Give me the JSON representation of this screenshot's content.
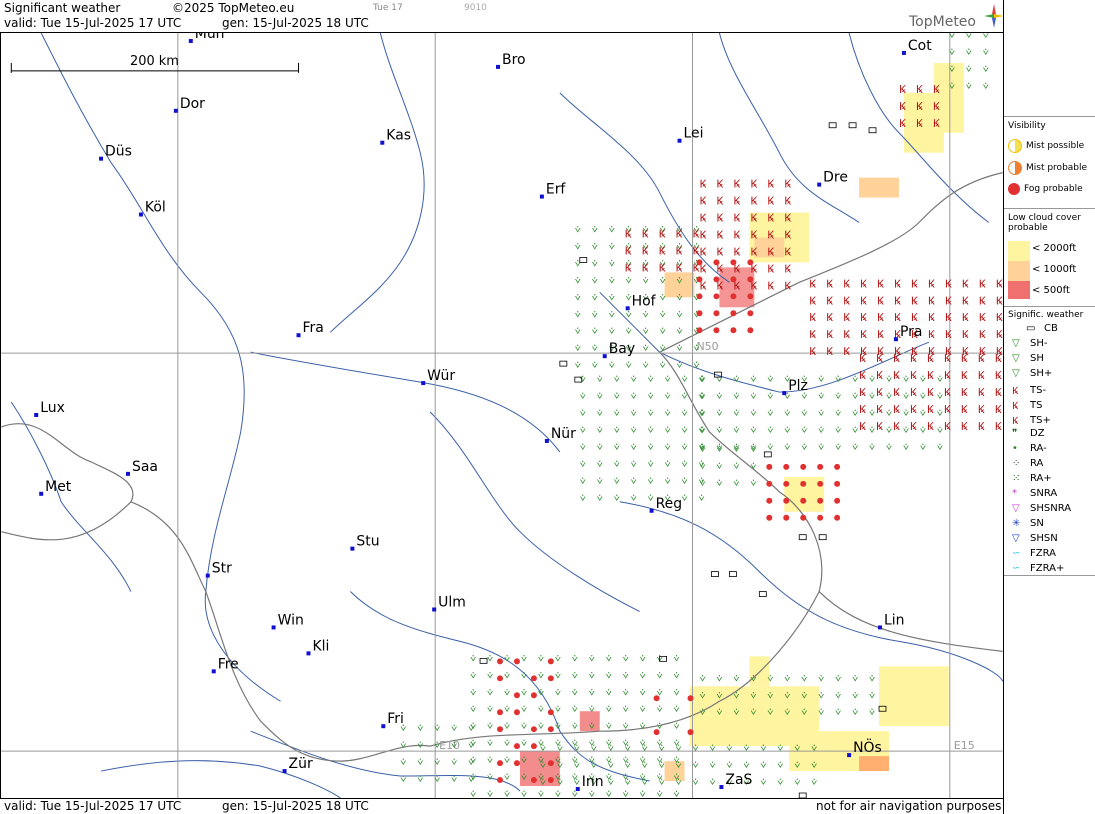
{
  "header": {
    "title": "Significant weather",
    "copyright": "©2025 TopMeteo.eu",
    "tab_day": "Tue 17",
    "code": "9010",
    "valid": "valid:  Tue  15-Jul-2025  17 UTC",
    "gen": "gen: 15-Jul-2025 18 UTC",
    "logo": "TopMeteo"
  },
  "footer": {
    "valid": "valid:  Tue  15-Jul-2025  17 UTC",
    "gen": "gen: 15-Jul-2025 18 UTC",
    "disclaimer": "not for air navigation purposes"
  },
  "map": {
    "scale_label": "200 km",
    "grid_labels": [
      "N50",
      "E10",
      "E15"
    ],
    "cities": [
      {
        "name": "Mün",
        "lbl": "Mün"
      },
      {
        "name": "Dor"
      },
      {
        "name": "Düs"
      },
      {
        "name": "Köl"
      },
      {
        "name": "Kas"
      },
      {
        "name": "Bro"
      },
      {
        "name": "Lei"
      },
      {
        "name": "Cot"
      },
      {
        "name": "Erf"
      },
      {
        "name": "Dre"
      },
      {
        "name": "Hof"
      },
      {
        "name": "Fra"
      },
      {
        "name": "Bay"
      },
      {
        "name": "Pra"
      },
      {
        "name": "Würzburg",
        "lbl": "Wür"
      },
      {
        "name": "Lux"
      },
      {
        "name": "Plz"
      },
      {
        "name": "Nür"
      },
      {
        "name": "Saa"
      },
      {
        "name": "Met"
      },
      {
        "name": "Reg"
      },
      {
        "name": "Stu"
      },
      {
        "name": "Str"
      },
      {
        "name": "Ulm"
      },
      {
        "name": "Win"
      },
      {
        "name": "Kli"
      },
      {
        "name": "Lin"
      },
      {
        "name": "Fre"
      },
      {
        "name": "Fri"
      },
      {
        "name": "NÖs"
      },
      {
        "name": "Zür"
      },
      {
        "name": "Inn"
      },
      {
        "name": "ZaS"
      }
    ]
  },
  "legend": {
    "visibility_title": "Visibility",
    "mist_possible": "Mist possible",
    "mist_probable": "Mist probable",
    "fog_probable": "Fog probable",
    "low_cloud_title": "Low cloud cover probable",
    "lc_2000": "< 2000ft",
    "lc_1000": "< 1000ft",
    "lc_500": "<   500ft",
    "signif_title": "Signific. weather",
    "items": [
      "CB",
      "SH-",
      "SH",
      "SH+",
      "TS-",
      "TS",
      "TS+",
      "DZ",
      "RA-",
      "RA",
      "RA+",
      "SNRA",
      "SHSNRA",
      "SN",
      "SHSN",
      "FZRA",
      "FZRA+"
    ],
    "colors": {
      "yellow": "#fff4a0",
      "orange": "#ffb070",
      "red": "#f07070",
      "green": "#2a8a2a",
      "ts": "#b01010",
      "fog": "#e03030"
    }
  }
}
